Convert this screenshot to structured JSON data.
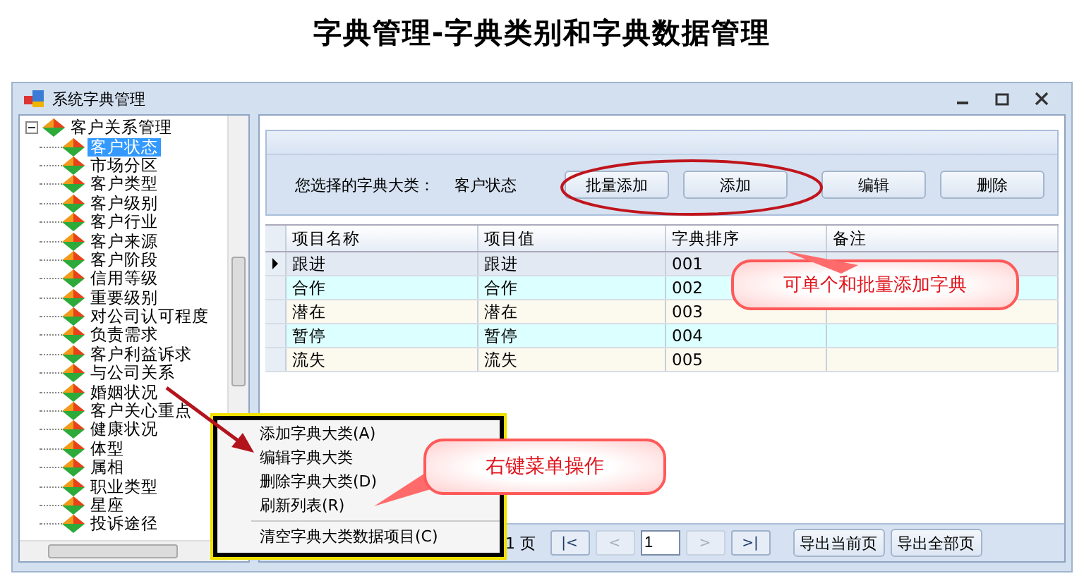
{
  "page_title": "字典管理-字典类别和字典数据管理",
  "window": {
    "title": "系统字典管理"
  },
  "tree": {
    "label": "客户关系管理",
    "expanded": true,
    "children": [
      {
        "label": "客户状态",
        "selected": true
      },
      {
        "label": "市场分区",
        "selected": false
      },
      {
        "label": "客户类型",
        "selected": false
      },
      {
        "label": "客户级别",
        "selected": false
      },
      {
        "label": "客户行业",
        "selected": false
      },
      {
        "label": "客户来源",
        "selected": false
      },
      {
        "label": "客户阶段",
        "selected": false
      },
      {
        "label": "信用等级",
        "selected": false
      },
      {
        "label": "重要级别",
        "selected": false
      },
      {
        "label": "对公司认可程度",
        "selected": false
      },
      {
        "label": "负责需求",
        "selected": false
      },
      {
        "label": "客户利益诉求",
        "selected": false
      },
      {
        "label": "与公司关系",
        "selected": false
      },
      {
        "label": "婚姻状况",
        "selected": false
      },
      {
        "label": "客户关心重点",
        "selected": false
      },
      {
        "label": "健康状况",
        "selected": false
      },
      {
        "label": "体型",
        "selected": false
      },
      {
        "label": "属相",
        "selected": false
      },
      {
        "label": "职业类型",
        "selected": false
      },
      {
        "label": "星座",
        "selected": false
      },
      {
        "label": "投诉途径",
        "selected": false
      }
    ]
  },
  "filter": {
    "label": "您选择的字典大类：",
    "value": "客户状态"
  },
  "buttons": [
    "批量添加",
    "添加",
    "编辑",
    "删除"
  ],
  "table": {
    "columns": [
      "项目名称",
      "项目值",
      "字典排序",
      "备注"
    ],
    "rows": [
      {
        "cells": [
          "跟进",
          "跟进",
          "001",
          ""
        ],
        "current": true
      },
      {
        "cells": [
          "合作",
          "合作",
          "002",
          ""
        ],
        "current": false
      },
      {
        "cells": [
          "潜在",
          "潜在",
          "003",
          ""
        ],
        "current": false
      },
      {
        "cells": [
          "暂停",
          "暂停",
          "004",
          ""
        ],
        "current": false
      },
      {
        "cells": [
          "流失",
          "流失",
          "005",
          ""
        ],
        "current": false
      }
    ]
  },
  "pager": {
    "page_text": "1 页",
    "nav": [
      {
        "label": "|<",
        "disabled": false
      },
      {
        "label": "<",
        "disabled": true
      },
      {
        "label": ">",
        "disabled": true
      },
      {
        "label": ">|",
        "disabled": false
      }
    ],
    "page": "1",
    "exports": [
      "导出当前页",
      "导出全部页"
    ]
  },
  "context_menu": {
    "items": [
      {
        "label": "添加字典大类(A)",
        "separator_before": false
      },
      {
        "label": "编辑字典大类",
        "separator_before": false
      },
      {
        "label": "删除字典大类(D)",
        "separator_before": false
      },
      {
        "label": "刷新列表(R)",
        "separator_before": false
      },
      {
        "label": "清空字典大类数据项目(C)",
        "separator_before": true
      }
    ]
  },
  "callouts": [
    "可单个和批量添加字典",
    "右键菜单操作"
  ]
}
